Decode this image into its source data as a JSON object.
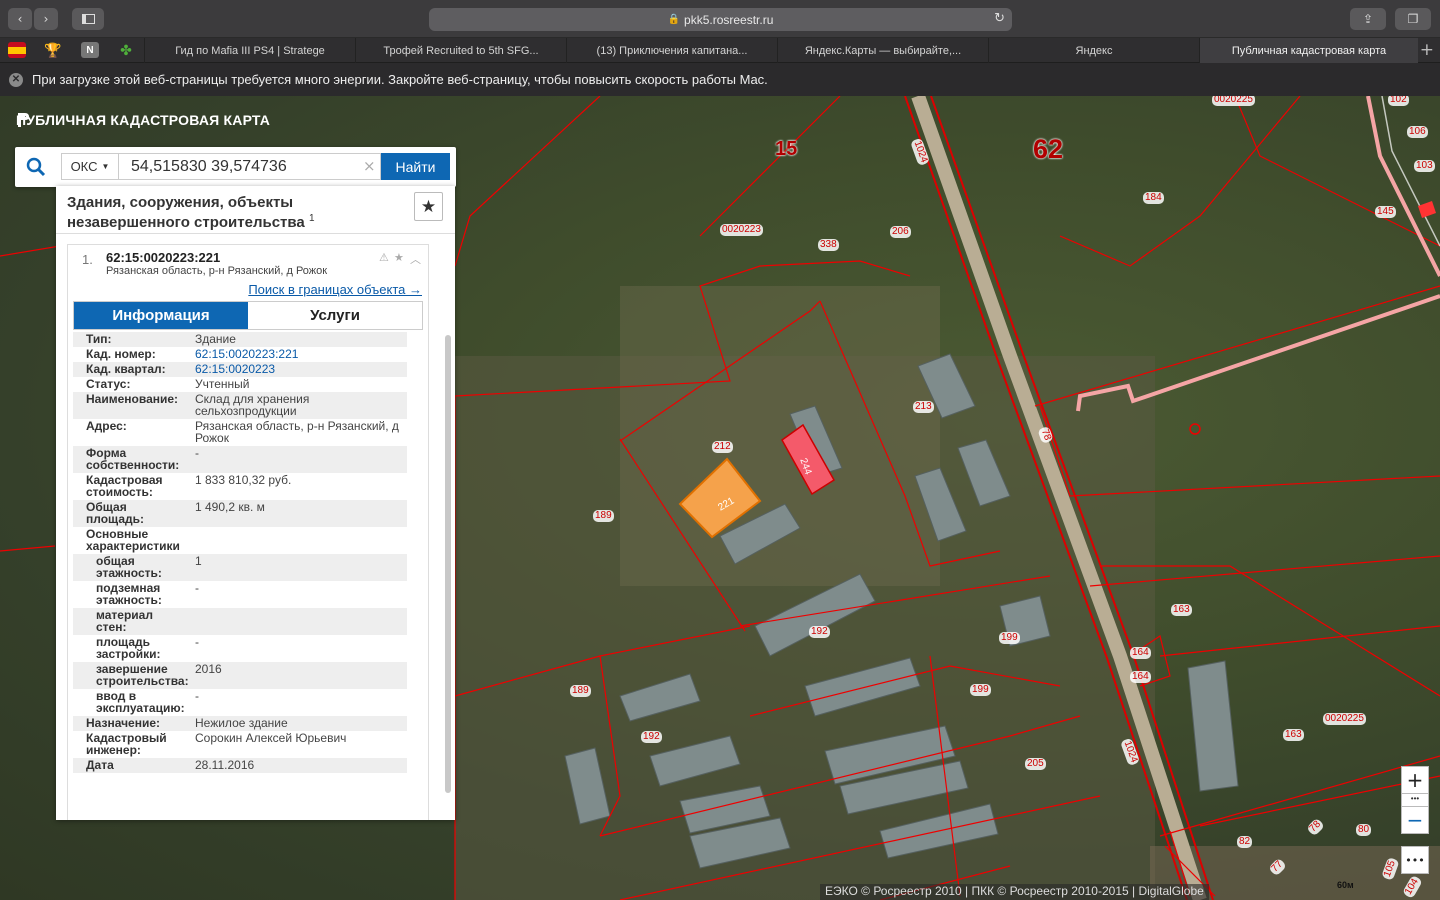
{
  "browser": {
    "url": "pkk5.rosreestr.ru",
    "tabs": [
      "Гид по Mafia III PS4 | Stratege",
      "Трофей Recruited to 5th SFG...",
      "(13) Приключения капитана...",
      "Яндекс.Карты — выбирайте,...",
      "Яндекс",
      "Публичная кадастровая карта"
    ],
    "new_tab": "+",
    "warning": "При загрузке этой веб-страницы требуется много энергии. Закройте веб-страницу, чтобы повысить скорость работы Mac."
  },
  "app": {
    "title": "ПУБЛИЧНАЯ КАДАСТРОВАЯ КАРТА"
  },
  "search": {
    "type": "ОКС",
    "value": "54,515830 39,574736",
    "clear": "×",
    "button": "Найти"
  },
  "panel": {
    "heading": "Здания, сооружения, объекты незавершенного строительства",
    "count": "1",
    "item": {
      "index": "1.",
      "cadnum": "62:15:0020223:221",
      "address": "Рязанская область, р-н Рязанский, д Рожок",
      "boundary_link": "Поиск в границах объекта →"
    },
    "tabs": {
      "info": "Информация",
      "services": "Услуги"
    },
    "rows": [
      {
        "k": "Тип:",
        "v": "Здание"
      },
      {
        "k": "Кад. номер:",
        "v": "62:15:0020223:221",
        "link": true
      },
      {
        "k": "Кад. квартал:",
        "v": "62:15:0020223",
        "link": true
      },
      {
        "k": "Статус:",
        "v": "Учтенный"
      },
      {
        "k": "Наименование:",
        "v": "Склад для хранения сельхозпродукции"
      },
      {
        "k": "Адрес:",
        "v": "Рязанская область, р-н Рязанский, д Рожок"
      },
      {
        "k": "Форма собственности:",
        "v": "-"
      },
      {
        "k": "Кадастровая стоимость:",
        "v": "1 833 810,32 руб."
      },
      {
        "k": "Общая площадь:",
        "v": "1 490,2 кв. м"
      },
      {
        "k": "Основные характеристики",
        "v": ""
      },
      {
        "k": "общая этажность:",
        "v": "1",
        "sub": true
      },
      {
        "k": "подземная этажность:",
        "v": "-",
        "sub": true
      },
      {
        "k": "материал стен:",
        "v": "",
        "sub": true
      },
      {
        "k": "площадь застройки:",
        "v": "-",
        "sub": true
      },
      {
        "k": "завершение строительства:",
        "v": "2016",
        "sub": true
      },
      {
        "k": "ввод в эксплуатацию:",
        "v": "-",
        "sub": true
      },
      {
        "k": "Назначение:",
        "v": "Нежилое здание"
      },
      {
        "k": "Кадастровый инженер:",
        "v": "Сорокин Алексей Юрьевич"
      },
      {
        "k": "Дата",
        "v": "28.11.2016"
      }
    ]
  },
  "map": {
    "labels": [
      {
        "t": "0020225"
      },
      {
        "t": "102"
      },
      {
        "t": "106"
      },
      {
        "t": "103"
      },
      {
        "t": "184"
      },
      {
        "t": "145"
      },
      {
        "t": "1024"
      },
      {
        "t": "0020223"
      },
      {
        "t": "338"
      },
      {
        "t": "206"
      },
      {
        "t": "212"
      },
      {
        "t": "213"
      },
      {
        "t": "78"
      },
      {
        "t": "221"
      },
      {
        "t": "244"
      },
      {
        "t": "189"
      },
      {
        "t": "192"
      },
      {
        "t": "199"
      },
      {
        "t": "199"
      },
      {
        "t": "163"
      },
      {
        "t": "164"
      },
      {
        "t": "164"
      },
      {
        "t": "189"
      },
      {
        "t": "192"
      },
      {
        "t": "205"
      },
      {
        "t": "0020225"
      },
      {
        "t": "163"
      },
      {
        "t": "1024"
      },
      {
        "t": "82"
      },
      {
        "t": "78"
      },
      {
        "t": "80"
      },
      {
        "t": "77"
      },
      {
        "t": "105"
      },
      {
        "t": "104"
      }
    ],
    "big_labels": [
      "15",
      "62"
    ],
    "zoom_in": "+",
    "zoom_out": "−",
    "more": "•••",
    "credits": "ЕЭКО © Росреестр 2010 | ПКК © Росреестр 2010-2015 | DigitalGlobe",
    "scale": "60м"
  }
}
